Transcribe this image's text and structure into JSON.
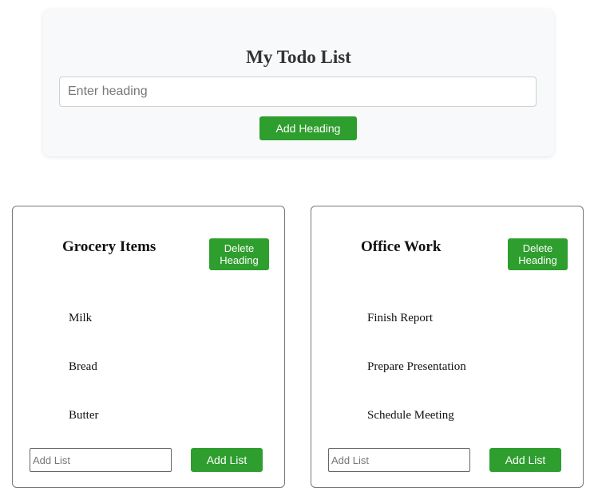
{
  "header": {
    "title": "My Todo List",
    "heading_input_placeholder": "Enter heading",
    "heading_input_value": "",
    "add_heading_label": "Add Heading"
  },
  "cards": [
    {
      "heading": "Grocery Items",
      "delete_label": "Delete Heading",
      "items": [
        "Milk",
        "Bread",
        "Butter"
      ],
      "list_input_placeholder": "Add List",
      "list_input_value": "",
      "add_list_label": "Add List"
    },
    {
      "heading": "Office Work",
      "delete_label": "Delete Heading",
      "items": [
        "Finish Report",
        "Prepare Presentation",
        "Schedule Meeting"
      ],
      "list_input_placeholder": "Add List",
      "list_input_value": "",
      "add_list_label": "Add List"
    }
  ],
  "colors": {
    "accent_green": "#2e9e2e",
    "panel_background": "#f8f9fa",
    "card_border": "#777777"
  }
}
